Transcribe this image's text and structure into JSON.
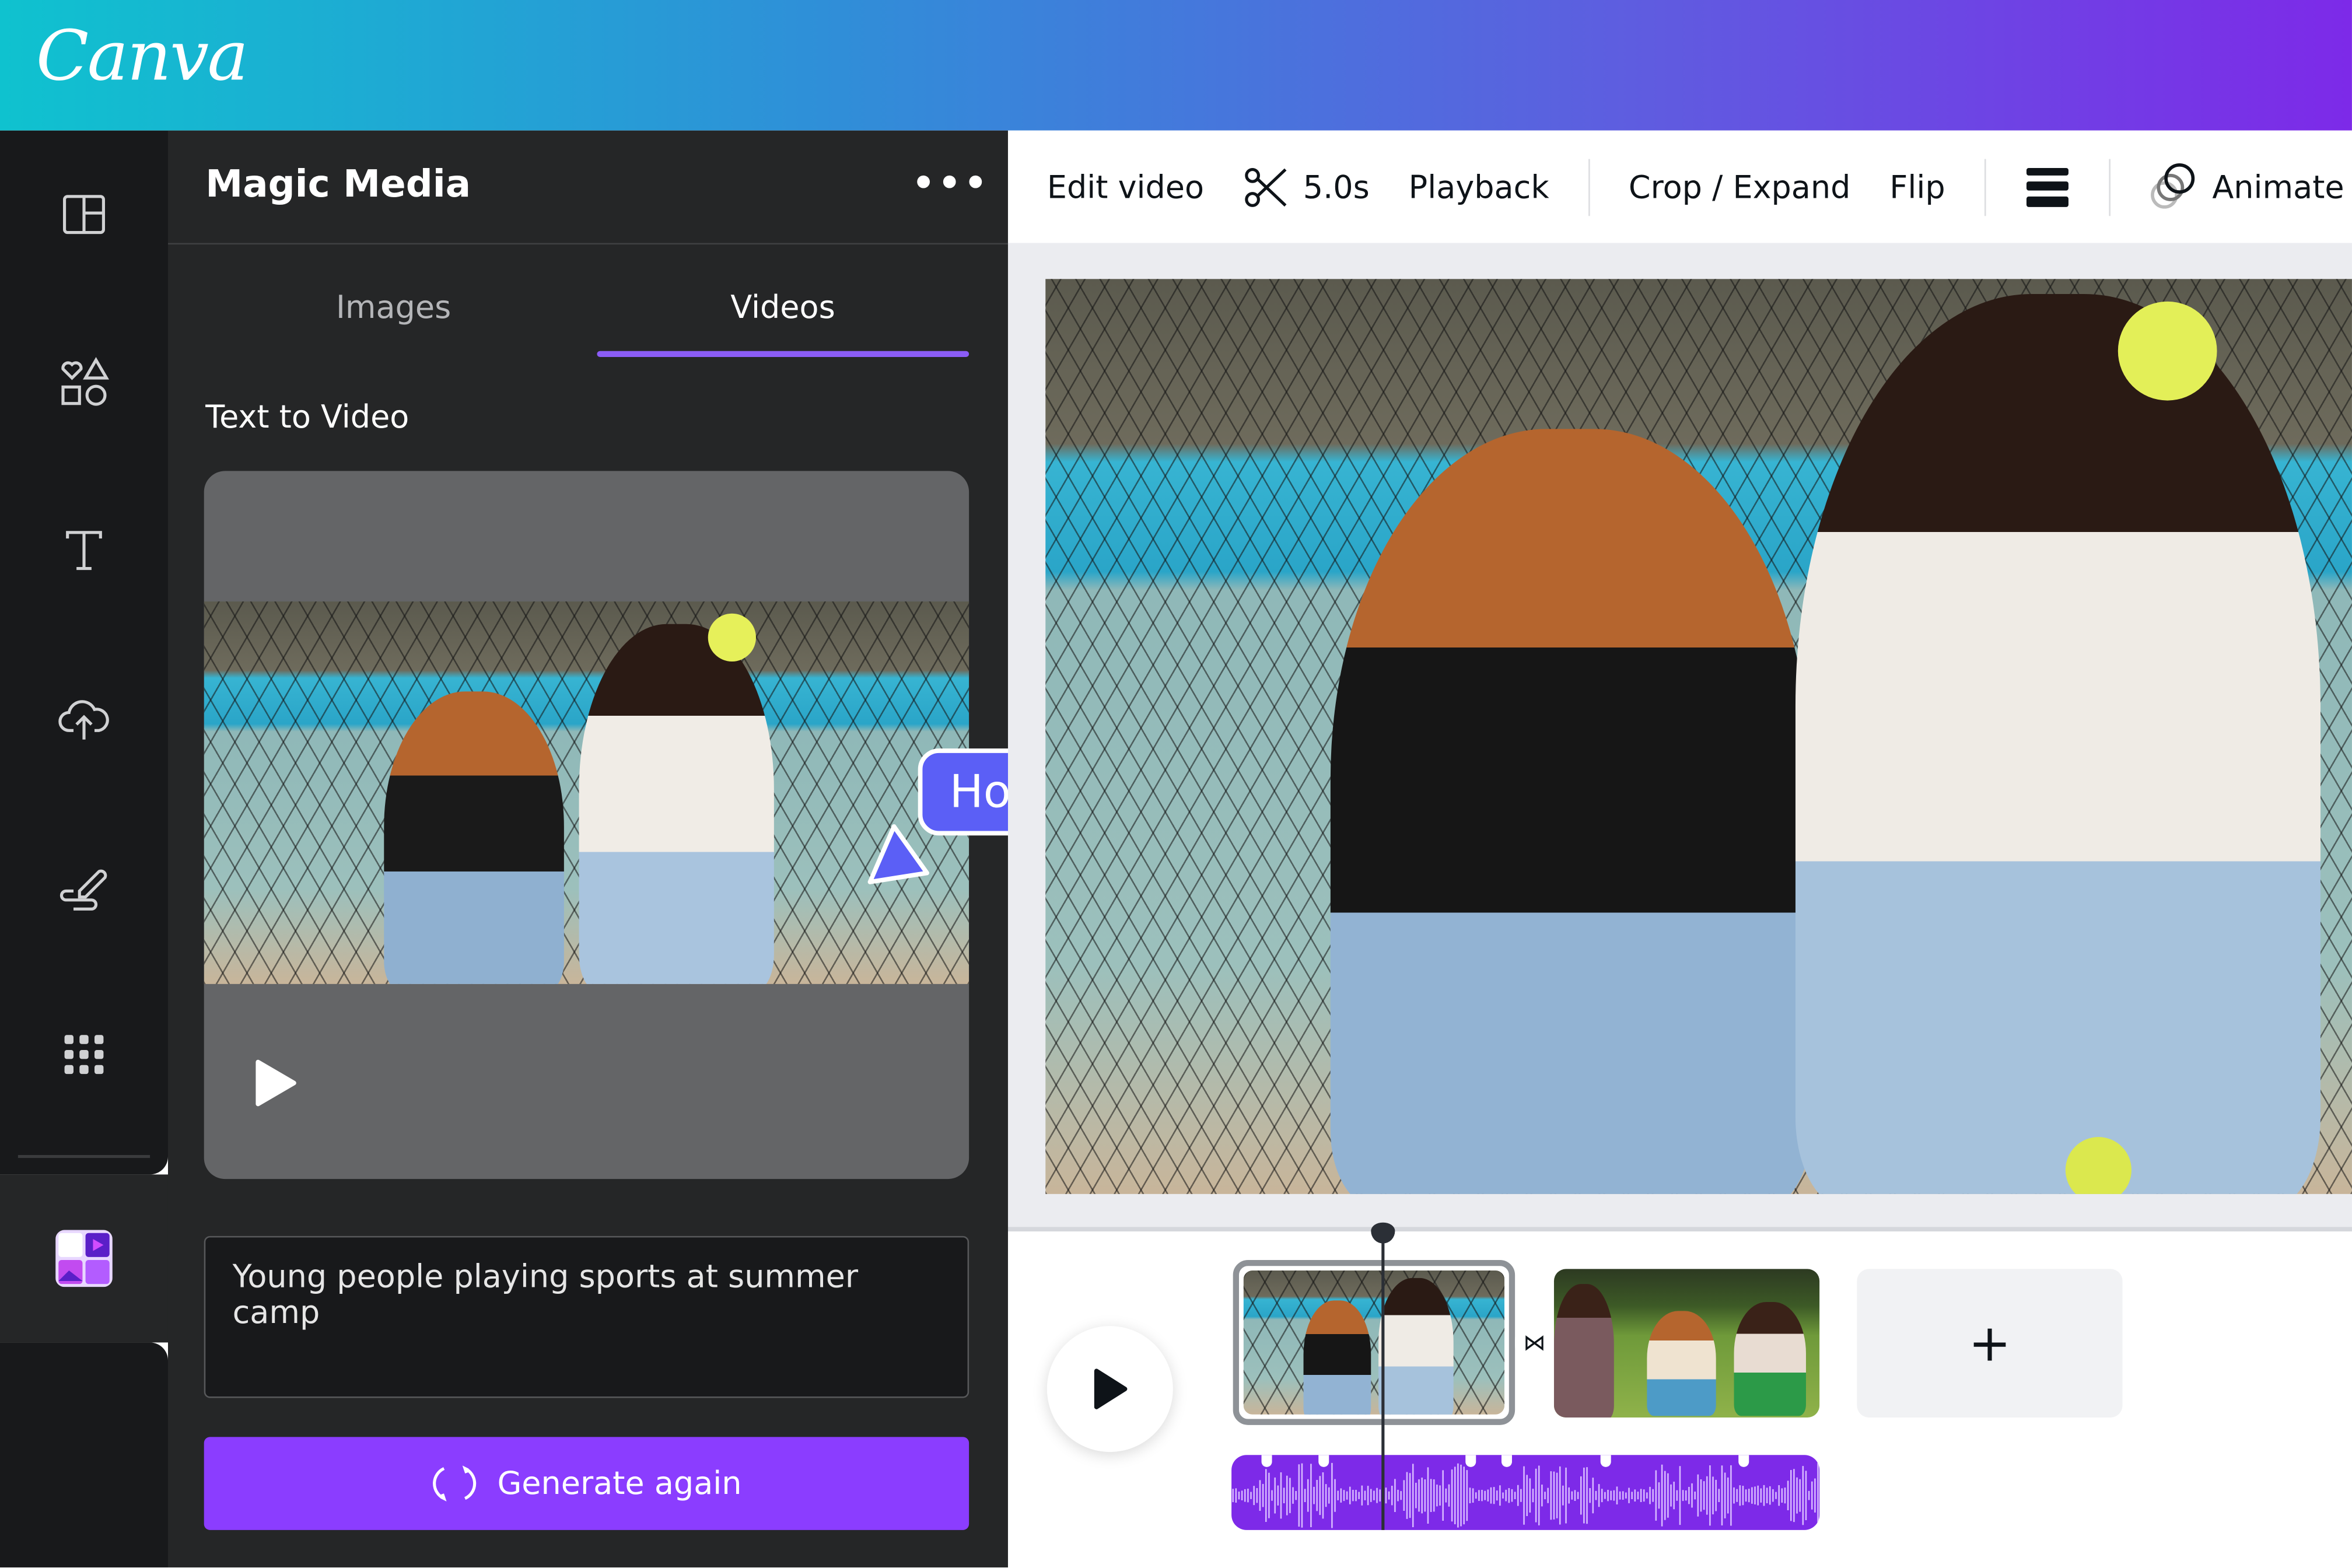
{
  "app": {
    "logo_text": "Canva",
    "brand_gradient": [
      "#0fc2cf",
      "#7d2ae8"
    ]
  },
  "rail": {
    "items": [
      {
        "icon": "layout-icon"
      },
      {
        "icon": "elements-icon"
      },
      {
        "icon": "text-icon"
      },
      {
        "icon": "upload-cloud-icon"
      },
      {
        "icon": "draw-icon"
      },
      {
        "icon": "apps-grid-icon"
      },
      {
        "icon": "magic-media-app-icon"
      }
    ]
  },
  "panel": {
    "title": "Magic Media",
    "more_label": "•••",
    "tabs": [
      {
        "label": "Images",
        "active": false
      },
      {
        "label": "Videos",
        "active": true
      }
    ],
    "section_title": "Text to Video",
    "prompt_value": "Young people playing sports at summer camp",
    "generate_label": "Generate again",
    "accent": "#8b3dff"
  },
  "collaborator": {
    "name": "Holly",
    "color": "#5b5ff6"
  },
  "toolbar": {
    "edit_video": "Edit video",
    "duration": "5.0s",
    "playback": "Playback",
    "crop_expand": "Crop / Expand",
    "flip": "Flip",
    "animate": "Animate"
  },
  "timeline": {
    "add_label": "+",
    "audio_color": "#7d2ae8"
  }
}
